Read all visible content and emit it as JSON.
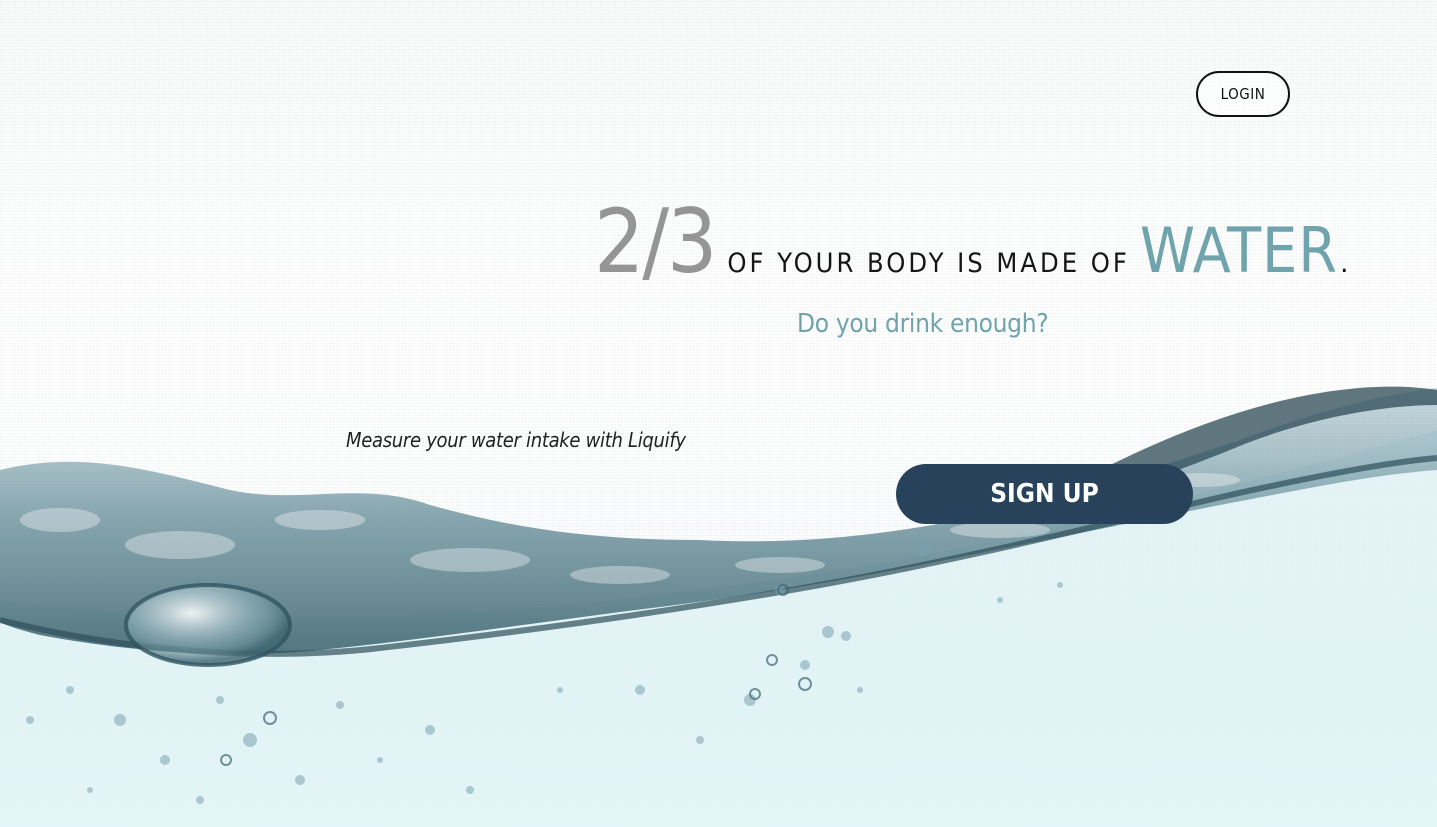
{
  "nav": {
    "login_label": "LOGIN"
  },
  "hero": {
    "fraction": "2/3",
    "middle_text": "OF YOUR BODY IS MADE OF",
    "highlight_word": "WATER",
    "period": ".",
    "subheadline": "Do you drink enough?",
    "tagline": "Measure your water intake with Liquify",
    "signup_label": "SIGN UP"
  },
  "colors": {
    "accent_teal": "#6fa4ad",
    "fraction_gray": "#959595",
    "signup_navy": "#28425c",
    "text_dark": "#151515"
  },
  "background": {
    "image": "water-splash-wave"
  }
}
